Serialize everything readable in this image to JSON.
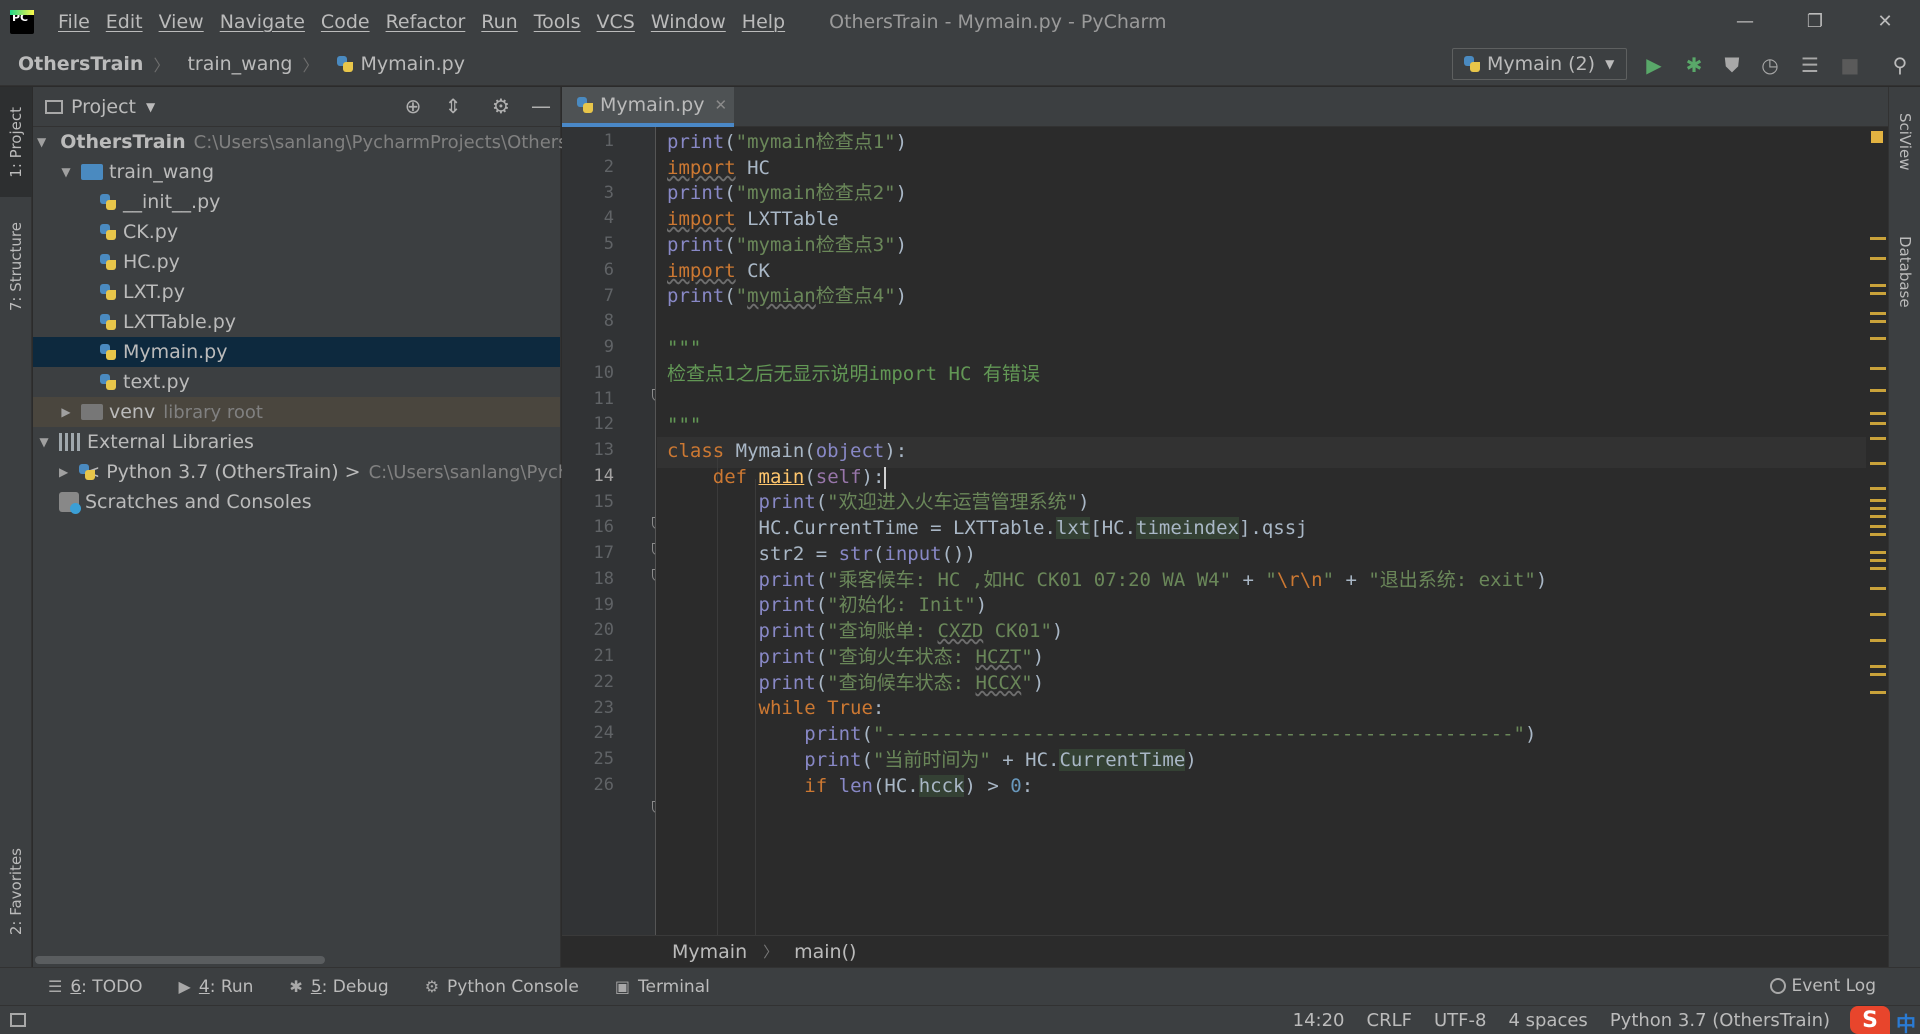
{
  "menu": [
    "File",
    "Edit",
    "View",
    "Navigate",
    "Code",
    "Refactor",
    "Run",
    "Tools",
    "VCS",
    "Window",
    "Help"
  ],
  "window_title": "OthersTrain - Mymain.py - PyCharm",
  "window_controls": {
    "minimize": "—",
    "restore": "❐",
    "close": "✕"
  },
  "breadcrumbs": [
    "OthersTrain",
    "train_wang",
    "Mymain.py"
  ],
  "run_config": "Mymain (2)",
  "left_tabs": {
    "project": "1: Project",
    "structure": "7: Structure",
    "favorites": "2: Favorites"
  },
  "right_tabs": {
    "sciview": "SciView",
    "database": "Database"
  },
  "project_panel": {
    "title": "Project",
    "root": {
      "name": "OthersTrain",
      "path": "C:\\Users\\sanlang\\PycharmProjects\\Others"
    },
    "folder": "train_wang",
    "files": [
      "__init__.py",
      "CK.py",
      "HC.py",
      "LXT.py",
      "LXTTable.py",
      "Mymain.py",
      "text.py"
    ],
    "venv": {
      "name": "venv",
      "hint": "library root"
    },
    "external_libraries": "External Libraries",
    "python_sdk": {
      "name": "< Python 3.7 (OthersTrain) >",
      "path": "C:\\Users\\sanlang\\Pych"
    },
    "scratches": "Scratches and Consoles"
  },
  "editor": {
    "tab": "Mymain.py",
    "current_line": 14,
    "line_numbers": [
      "1",
      "2",
      "3",
      "4",
      "5",
      "6",
      "7",
      "8",
      "9",
      "10",
      "11",
      "12",
      "13",
      "14",
      "15",
      "16",
      "17",
      "18",
      "19",
      "20",
      "21",
      "22",
      "23",
      "24",
      "25",
      "26"
    ]
  },
  "editor_breadcrumbs": [
    "Mymain",
    "main()"
  ],
  "tool_windows": [
    {
      "num": "6",
      "label": ": TODO",
      "icon": "☰"
    },
    {
      "num": "4",
      "label": ": Run",
      "icon": "▶"
    },
    {
      "num": "5",
      "label": ": Debug",
      "icon": "✱"
    },
    {
      "num": "",
      "label": "Python Console",
      "icon": "⚙"
    },
    {
      "num": "",
      "label": "Terminal",
      "icon": "▣"
    }
  ],
  "event_log": "Event Log",
  "status": {
    "position": "14:20",
    "line_sep": "CRLF",
    "encoding": "UTF-8",
    "indent": "4 spaces",
    "interpreter": "Python 3.7 (OthersTrain)"
  },
  "ime": {
    "logo": "S",
    "mode": "中"
  }
}
